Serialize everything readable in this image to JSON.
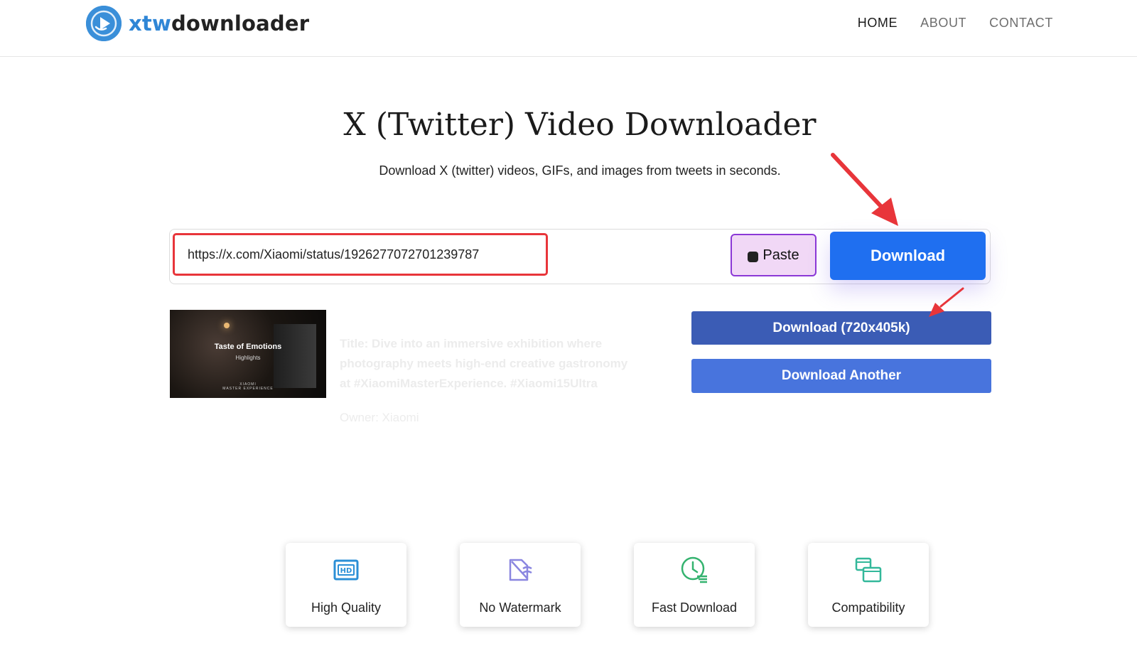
{
  "header": {
    "logo_text_accent": "xtw",
    "logo_text_main": "downloader",
    "nav": [
      {
        "label": "HOME",
        "active": true
      },
      {
        "label": "ABOUT",
        "active": false
      },
      {
        "label": "CONTACT",
        "active": false
      }
    ]
  },
  "hero": {
    "title": "X (Twitter) Video Downloader",
    "subtitle": "Download X (twitter) videos, GIFs, and images from tweets in seconds."
  },
  "search": {
    "url_value": "https://x.com/Xiaomi/status/1926277072701239787",
    "paste_label": "Paste",
    "download_label": "Download"
  },
  "result": {
    "thumbnail": {
      "title": "Taste of Emotions",
      "subtitle": "Highlights",
      "brand_line1": "XIAOMI",
      "brand_line2": "MASTER EXPERIENCE"
    },
    "title_label": "Title:",
    "title_text": "Dive into an immersive exhibition where photography meets high-end creative gastronomy at #XiaomiMasterExperience. #Xiaomi15Ultra",
    "owner_label": "Owner:",
    "owner_text": "Xiaomi",
    "download_quality_label": "Download (720x405k)",
    "download_another_label": "Download Another"
  },
  "features": [
    {
      "label": "High Quality",
      "icon": "hd-icon",
      "color": "#2b8fd6"
    },
    {
      "label": "No Watermark",
      "icon": "no-watermark-icon",
      "color": "#8a86e0"
    },
    {
      "label": "Fast Download",
      "icon": "clock-fast-icon",
      "color": "#34b36f"
    },
    {
      "label": "Compatibility",
      "icon": "devices-icon",
      "color": "#33b89a"
    }
  ],
  "colors": {
    "primary_button": "#1f6ff0",
    "quality_button": "#3b5cb5",
    "another_button": "#4874dd",
    "annotation_red": "#e8353a",
    "paste_bg": "#f1d8f6",
    "paste_border": "#8b38d6"
  }
}
